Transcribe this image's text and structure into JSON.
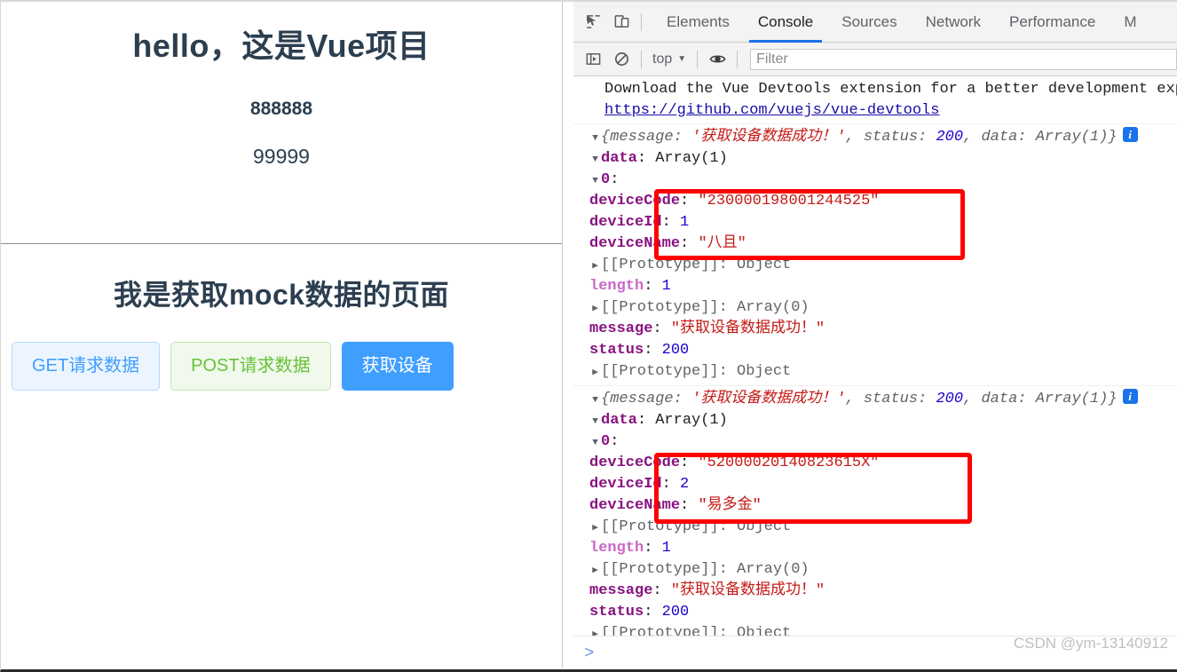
{
  "page": {
    "hero": {
      "title": "hello，这是Vue项目",
      "num1": "888888",
      "num2": "99999"
    },
    "mock": {
      "title": "我是获取mock数据的页面",
      "buttons": [
        {
          "label": "GET请求数据",
          "style": "primary-plain"
        },
        {
          "label": "POST请求数据",
          "style": "success-plain"
        },
        {
          "label": "获取设备",
          "style": "primary"
        }
      ]
    },
    "colors": {
      "heading": "#2c3e50",
      "primary": "#409EFF",
      "success": "#67c23a",
      "primary_plain_bg": "#ecf5ff",
      "success_plain_bg": "#f0f9eb"
    }
  },
  "devtools": {
    "icons": {
      "inspect": "inspect-element-icon",
      "device": "device-toolbar-icon",
      "sidebar": "console-sidebar-icon",
      "clear": "clear-console-icon",
      "eye": "live-expression-eye-icon",
      "caret": "▼"
    },
    "tabs": [
      {
        "label": "Elements",
        "active": false
      },
      {
        "label": "Console",
        "active": true
      },
      {
        "label": "Sources",
        "active": false
      },
      {
        "label": "Network",
        "active": false
      },
      {
        "label": "Performance",
        "active": false
      },
      {
        "label": "M",
        "active": false
      }
    ],
    "filterbar": {
      "context": "top",
      "filter_value": "",
      "filter_placeholder": "Filter"
    },
    "vue_notice": {
      "line1": "Download the Vue Devtools extension for a better development expe",
      "link": "https://github.com/vuejs/vue-devtools"
    },
    "logs": [
      {
        "preview_open": "{message: ",
        "preview_msg": "'获取设备数据成功！'",
        "preview_mid": ", status: ",
        "preview_status": "200",
        "preview_data_label": ", data: ",
        "preview_data": "Array(1)",
        "preview_close": "}",
        "info_badge": "i",
        "data_key": "data",
        "data_val": "Array(1)",
        "index_key": "0",
        "fields": [
          {
            "key": "deviceCode",
            "value": "\"230000198001244525\"",
            "type": "string"
          },
          {
            "key": "deviceId",
            "value": "1",
            "type": "number"
          },
          {
            "key": "deviceName",
            "value": "\"八且\"",
            "type": "string"
          }
        ],
        "proto_inner": "[[Prototype]]: Object",
        "length_key": "length",
        "length_val": "1",
        "proto_array": "[[Prototype]]: Array(0)",
        "message_key": "message",
        "message_val": "\"获取设备数据成功！\"",
        "status_key": "status",
        "status_val": "200",
        "proto_outer": "[[Prototype]]: Object"
      },
      {
        "preview_open": "{message: ",
        "preview_msg": "'获取设备数据成功！'",
        "preview_mid": ", status: ",
        "preview_status": "200",
        "preview_data_label": ", data: ",
        "preview_data": "Array(1)",
        "preview_close": "}",
        "info_badge": "i",
        "data_key": "data",
        "data_val": "Array(1)",
        "index_key": "0",
        "fields": [
          {
            "key": "deviceCode",
            "value": "\"52000020140823615X\"",
            "type": "string"
          },
          {
            "key": "deviceId",
            "value": "2",
            "type": "number"
          },
          {
            "key": "deviceName",
            "value": "\"易多金\"",
            "type": "string"
          }
        ],
        "proto_inner": "[[Prototype]]: Object",
        "length_key": "length",
        "length_val": "1",
        "proto_array": "[[Prototype]]: Array(0)",
        "message_key": "message",
        "message_val": "\"获取设备数据成功！\"",
        "status_key": "status",
        "status_val": "200",
        "proto_outer": "[[Prototype]]: Object"
      }
    ],
    "prompt": ">",
    "annotation_color": "#ff0000"
  },
  "watermark": "CSDN @ym-13140912"
}
